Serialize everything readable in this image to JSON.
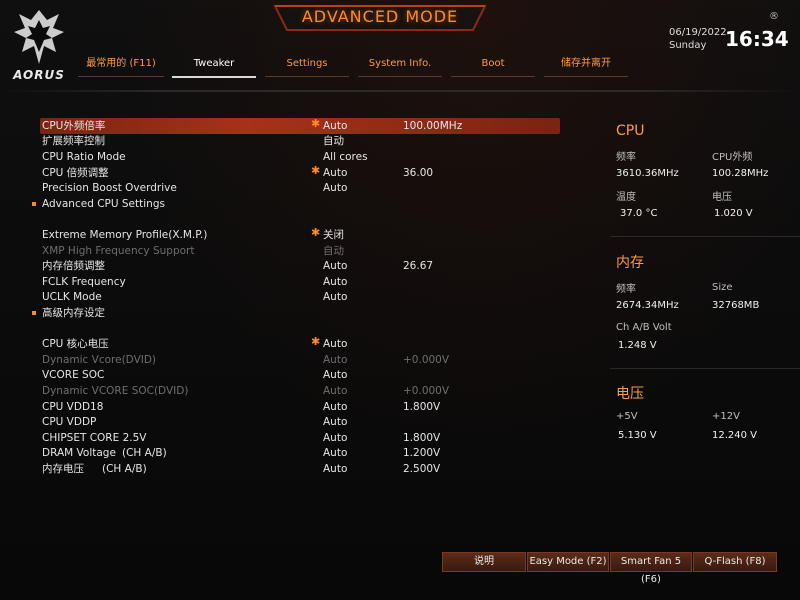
{
  "header": {
    "logo_text": "AORUS",
    "title": "ADVANCED MODE",
    "date": "06/19/2022",
    "weekday": "Sunday",
    "time": "16:34",
    "corner": "®"
  },
  "nav": {
    "tabs": [
      {
        "label": "最常用的 (F11)"
      },
      {
        "label": "Tweaker"
      },
      {
        "label": "Settings"
      },
      {
        "label": "System Info."
      },
      {
        "label": "Boot"
      },
      {
        "label": "储存并离开"
      }
    ]
  },
  "settings": [
    {
      "label": "CPU外频倍率",
      "value": "Auto",
      "value2": "100.00MHz",
      "starred": true
    },
    {
      "label": "扩展频率控制",
      "value": "自动",
      "value2": "",
      "starred": false
    },
    {
      "label": "CPU Ratio Mode",
      "value": "All cores",
      "value2": "",
      "starred": false
    },
    {
      "label": "CPU 倍频调整",
      "value": "Auto",
      "value2": "36.00",
      "starred": true
    },
    {
      "label": "Precision Boost Overdrive",
      "value": "Auto",
      "value2": "",
      "starred": false
    },
    {
      "label": "Advanced CPU Settings",
      "value": "",
      "value2": "",
      "starred": false
    },
    {
      "label": "Extreme Memory Profile(X.M.P.)",
      "value": "关闭",
      "value2": "",
      "starred": true
    },
    {
      "label": "XMP High Frequency Support",
      "value": "自动",
      "value2": "",
      "starred": false
    },
    {
      "label": "内存倍频调整",
      "value": "Auto",
      "value2": "26.67",
      "starred": false
    },
    {
      "label": "FCLK Frequency",
      "value": "Auto",
      "value2": "",
      "starred": false
    },
    {
      "label": "UCLK Mode",
      "value": "Auto",
      "value2": "",
      "starred": false
    },
    {
      "label": "高级内存设定",
      "value": "",
      "value2": "",
      "starred": false
    },
    {
      "label": "CPU 核心电压",
      "value": "Auto",
      "value2": "",
      "starred": true
    },
    {
      "label": "Dynamic Vcore(DVID)",
      "value": "Auto",
      "value2": "+0.000V",
      "starred": false
    },
    {
      "label": "VCORE SOC",
      "value": "Auto",
      "value2": "",
      "starred": false
    },
    {
      "label": "Dynamic VCORE SOC(DVID)",
      "value": "Auto",
      "value2": "+0.000V",
      "starred": false
    },
    {
      "label": "CPU VDD18",
      "value": "Auto",
      "value2": "1.800V",
      "starred": false
    },
    {
      "label": "CPU VDDP",
      "value": "Auto",
      "value2": "",
      "starred": false
    },
    {
      "label": "CHIPSET CORE 2.5V",
      "value": "Auto",
      "value2": "1.800V",
      "starred": false
    },
    {
      "label": "DRAM Voltage",
      "sub": "(CH A/B)",
      "value": "Auto",
      "value2": "1.200V",
      "starred": false
    },
    {
      "label": "内存电压",
      "sub": "(CH A/B)",
      "value": "Auto",
      "value2": "2.500V",
      "starred": false
    }
  ],
  "panel": {
    "cpu": {
      "title": "CPU",
      "freq_label": "频率",
      "freq_value": "3610.36MHz",
      "bclk_label": "CPU外频",
      "bclk_value": "100.28MHz",
      "temp_label": "温度",
      "temp_value": "37.0 °C",
      "volt_label": "电压",
      "volt_value": "1.020 V"
    },
    "memory": {
      "title": "内存",
      "freq_label": "频率",
      "freq_value": "2674.34MHz",
      "size_label": "Size",
      "size_value": "32768MB",
      "volt_label": "Ch A/B Volt",
      "volt_value": "1.248 V"
    },
    "voltage": {
      "title": "电压",
      "v5_label": "+5V",
      "v5_value": "5.130 V",
      "v12_label": "+12V",
      "v12_value": "12.240 V"
    }
  },
  "bottom": {
    "help": "说明",
    "easy_mode": "Easy Mode (F2)",
    "smart_fan": "Smart Fan 5 (F6)",
    "qflash": "Q-Flash (F8)"
  },
  "colors": {
    "accent": "#ff8a2a",
    "selected_row": "#a63217",
    "disabled_text": "#6e6e6e"
  }
}
